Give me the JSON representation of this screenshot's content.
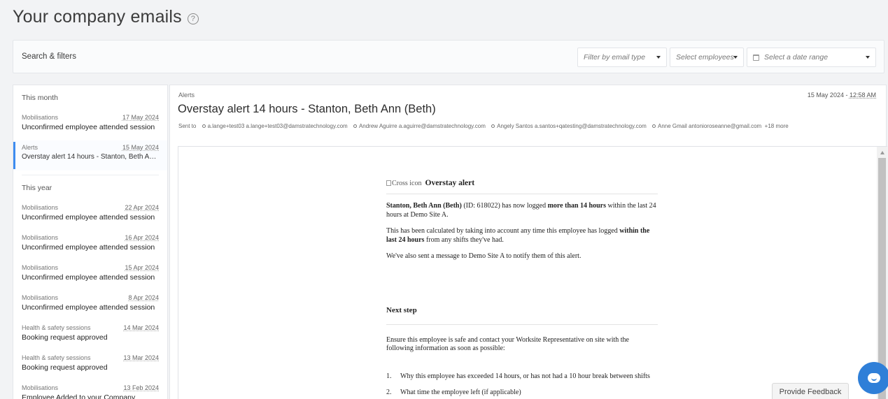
{
  "page": {
    "title": "Your company emails",
    "help_icon": "help-circle-icon"
  },
  "filters": {
    "label": "Search & filters",
    "email_type_placeholder": "Filter by email type",
    "employees_placeholder": "Select employees",
    "date_range_placeholder": "Select a date range"
  },
  "sections": {
    "this_month": "This month",
    "this_year": "This year"
  },
  "list": {
    "this_month": [
      {
        "category": "Mobilisations",
        "date": "17 May 2024",
        "title": "Unconfirmed employee attended session"
      },
      {
        "category": "Alerts",
        "date": "15 May 2024",
        "title": "Overstay alert 14 hours - Stanton, Beth Ann (Beth)",
        "active": true
      }
    ],
    "this_year": [
      {
        "category": "Mobilisations",
        "date": "22 Apr 2024",
        "title": "Unconfirmed employee attended session"
      },
      {
        "category": "Mobilisations",
        "date": "16 Apr 2024",
        "title": "Unconfirmed employee attended session"
      },
      {
        "category": "Mobilisations",
        "date": "15 Apr 2024",
        "title": "Unconfirmed employee attended session"
      },
      {
        "category": "Mobilisations",
        "date": "8 Apr 2024",
        "title": "Unconfirmed employee attended session"
      },
      {
        "category": "Health & safety sessions",
        "date": "14 Mar 2024",
        "title": "Booking request approved"
      },
      {
        "category": "Health & safety sessions",
        "date": "13 Mar 2024",
        "title": "Booking request approved"
      },
      {
        "category": "Mobilisations",
        "date": "13 Feb 2024",
        "title": "Employee Added to your Company"
      }
    ]
  },
  "detail": {
    "category": "Alerts",
    "date": "15 May 2024 - ",
    "time": "12:58 AM",
    "title": "Overstay alert 14 hours - Stanton, Beth Ann (Beth)",
    "sent_to_label": "Sent to",
    "recipients": [
      "a.lange+test03 a.lange+test03@damstratechnology.com",
      "Andrew Aguirre a.aguirre@damstratechnology.com",
      "Angely Santos a.santos+qatesting@damstratechnology.com",
      "Anne Gmail antonioroseanne@gmail.com"
    ],
    "more": "+18 more"
  },
  "email": {
    "cross_img_alt": "Cross icon",
    "heading": "Overstay alert",
    "p1_name": "Stanton, Beth Ann (Beth)",
    "p1_mid": " (ID: 618022) has now logged ",
    "p1_bold": "more than 14 hours",
    "p1_end": " within the last 24 hours at Demo Site A.",
    "p2_start": "This has been calculated by taking into account any time this employee has logged ",
    "p2_bold": "within the last 24 hours",
    "p2_end": " from any shifts they've had.",
    "p3": "We've also sent a message to Demo Site A to notify them of this alert.",
    "next_step": "Next step",
    "p4": "Ensure this employee is safe and contact your Worksite Representative on site with the following information as soon as possible:",
    "steps": [
      {
        "num": "1.",
        "text": "Why this employee has exceeded 14 hours, or has not had a 10 hour break between shifts"
      },
      {
        "num": "2.",
        "text": "What time the employee left (if applicable)"
      }
    ]
  },
  "feedback": {
    "label": "Provide Feedback"
  },
  "chat": {
    "icon": "chat-bubble-icon"
  },
  "colors": {
    "accent": "#3d8cf0",
    "chat": "#2f7fd8"
  }
}
